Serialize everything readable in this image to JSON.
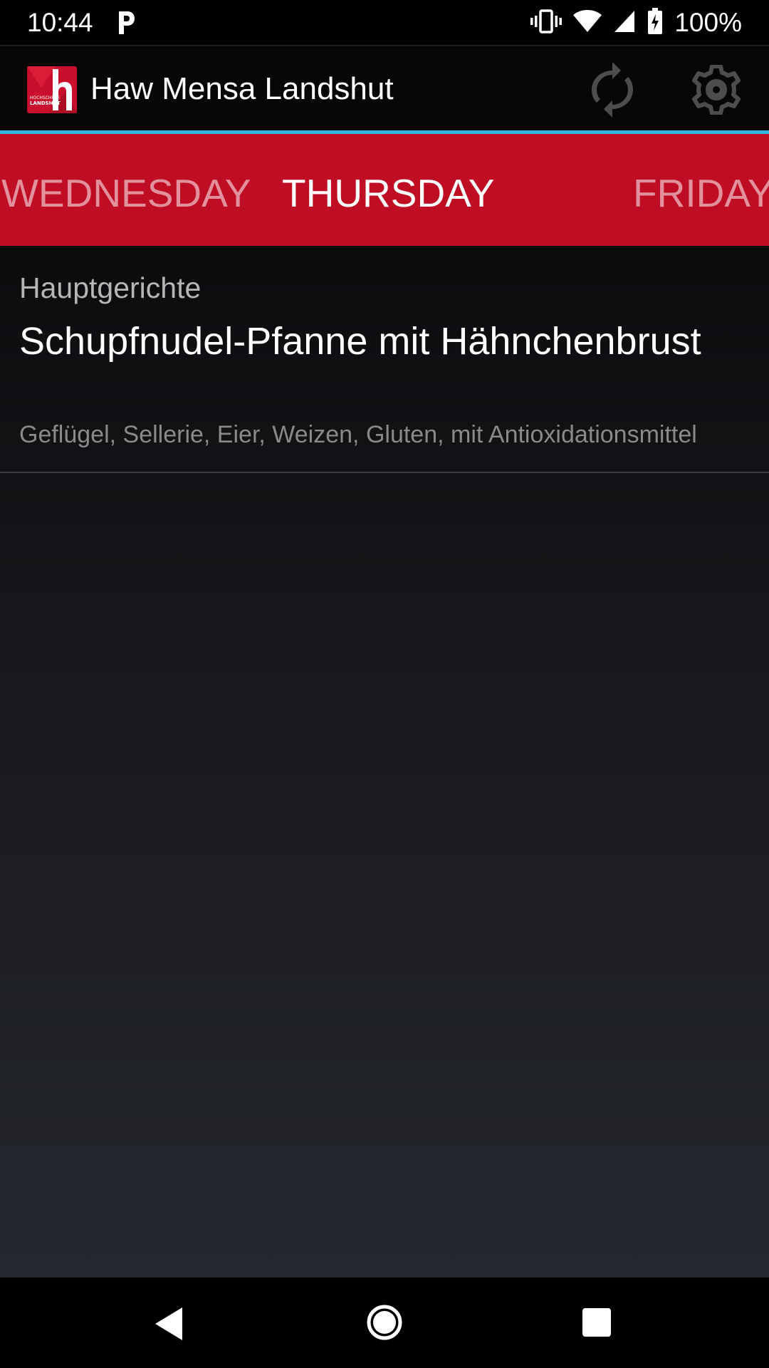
{
  "status_bar": {
    "time": "10:44",
    "battery": "100%",
    "icons": [
      "parking-notification-icon",
      "vibrate-icon",
      "wifi-icon",
      "cell-signal-icon",
      "battery-charging-icon"
    ]
  },
  "app_bar": {
    "title": "Haw Mensa Landshut",
    "logo_text_line1": "HOCHSCHULE",
    "logo_text_line2": "LANDSHUT",
    "actions": [
      "refresh-icon",
      "settings-icon"
    ],
    "accent_underline_color": "#33b5e5"
  },
  "tabs": {
    "previous": "WEDNESDAY",
    "current": "THURSDAY",
    "next": "FRIDAY",
    "background_color": "#bf0d24"
  },
  "meals": [
    {
      "category": "Hauptgerichte",
      "name": "Schupfnudel-Pfanne mit Hähnchenbrust",
      "allergens": "Geflügel, Sellerie, Eier, Weizen, Gluten, mit Antioxidationsmittel"
    }
  ],
  "nav_bar": {
    "buttons": [
      "back-icon",
      "home-icon",
      "recents-icon"
    ]
  }
}
